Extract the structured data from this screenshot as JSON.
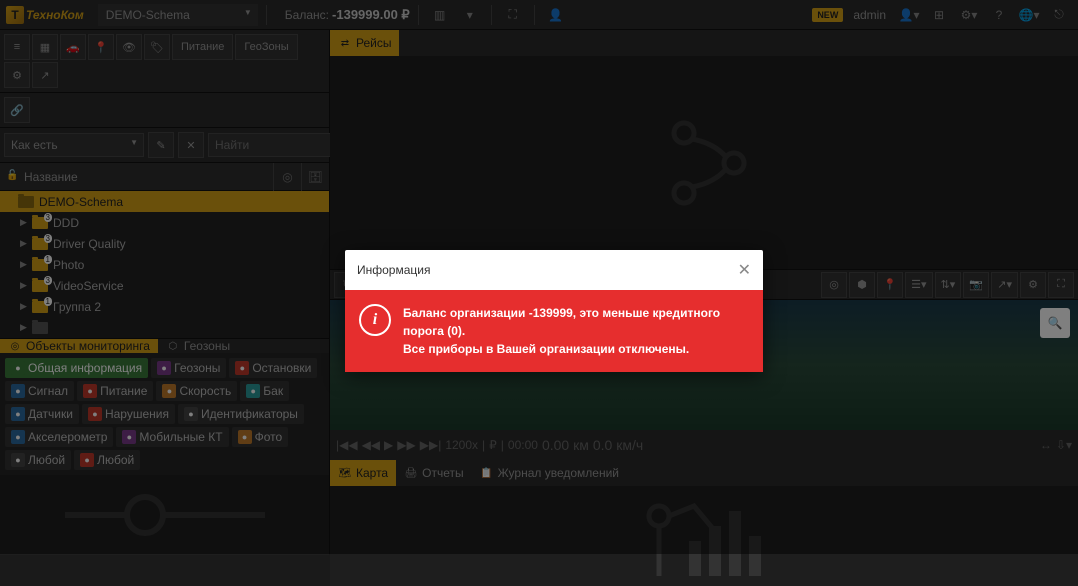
{
  "topbar": {
    "logo": "ТехноКом",
    "schema": "DEMO-Schema",
    "balance_label": "Баланс:",
    "balance_value": "-139999.00 ₽",
    "new_badge": "NEW",
    "user": "admin"
  },
  "left_toolbar": {
    "btn_power": "Питание",
    "btn_geozones": "ГеоЗоны"
  },
  "filter": {
    "mode": "Как есть",
    "search_placeholder": "Найти"
  },
  "tree_header": {
    "name": "Название"
  },
  "tree": [
    {
      "label": "DEMO-Schema",
      "selected": true,
      "indent": 0,
      "badge": null,
      "arrow": false
    },
    {
      "label": "DDD",
      "indent": 1,
      "badge": "3",
      "arrow": true
    },
    {
      "label": "Driver Quality",
      "indent": 1,
      "badge": "3",
      "arrow": true
    },
    {
      "label": "Photo",
      "indent": 1,
      "badge": "1",
      "arrow": true
    },
    {
      "label": "VideoService",
      "indent": 1,
      "badge": "3",
      "arrow": true
    },
    {
      "label": "Группа 2",
      "indent": 1,
      "badge": "1",
      "arrow": true
    },
    {
      "label": "",
      "indent": 1,
      "badge": null,
      "arrow": true,
      "grey": true
    }
  ],
  "left_tabs": {
    "objects": "Объекты мониторинга",
    "geozones": "Геозоны"
  },
  "ptabs": [
    {
      "label": "Общая информация",
      "c": "pi-green",
      "active": true
    },
    {
      "label": "Геозоны",
      "c": "pi-purple"
    },
    {
      "label": "Остановки",
      "c": "pi-red"
    },
    {
      "label": "Сигнал",
      "c": "pi-blue"
    },
    {
      "label": "Питание",
      "c": "pi-red"
    },
    {
      "label": "Скорость",
      "c": "pi-orange"
    },
    {
      "label": "Бак",
      "c": "pi-cyan"
    },
    {
      "label": "Датчики",
      "c": "pi-blue"
    },
    {
      "label": "Нарушения",
      "c": "pi-red"
    },
    {
      "label": "Идентификаторы",
      "c": "pi-dark"
    },
    {
      "label": "Акселерометр",
      "c": "pi-blue"
    },
    {
      "label": "Мобильные КТ",
      "c": "pi-purple"
    },
    {
      "label": "Фото",
      "c": "pi-orange"
    },
    {
      "label": "Любой",
      "c": "pi-dark"
    },
    {
      "label": "Любой",
      "c": "pi-red"
    }
  ],
  "right_top_tab": "Рейсы",
  "play": {
    "speed": "1200x",
    "time": "00:00",
    "dist": "0.00 км",
    "vel": "0.0 км/ч"
  },
  "bot_tabs": {
    "map": "Карта",
    "reports": "Отчеты",
    "journal": "Журнал уведомлений"
  },
  "modal": {
    "title": "Информация",
    "line1": "Баланс организации -139999, это меньше кредитного порога (0).",
    "line2": "Все приборы в Вашей организации отключены."
  }
}
